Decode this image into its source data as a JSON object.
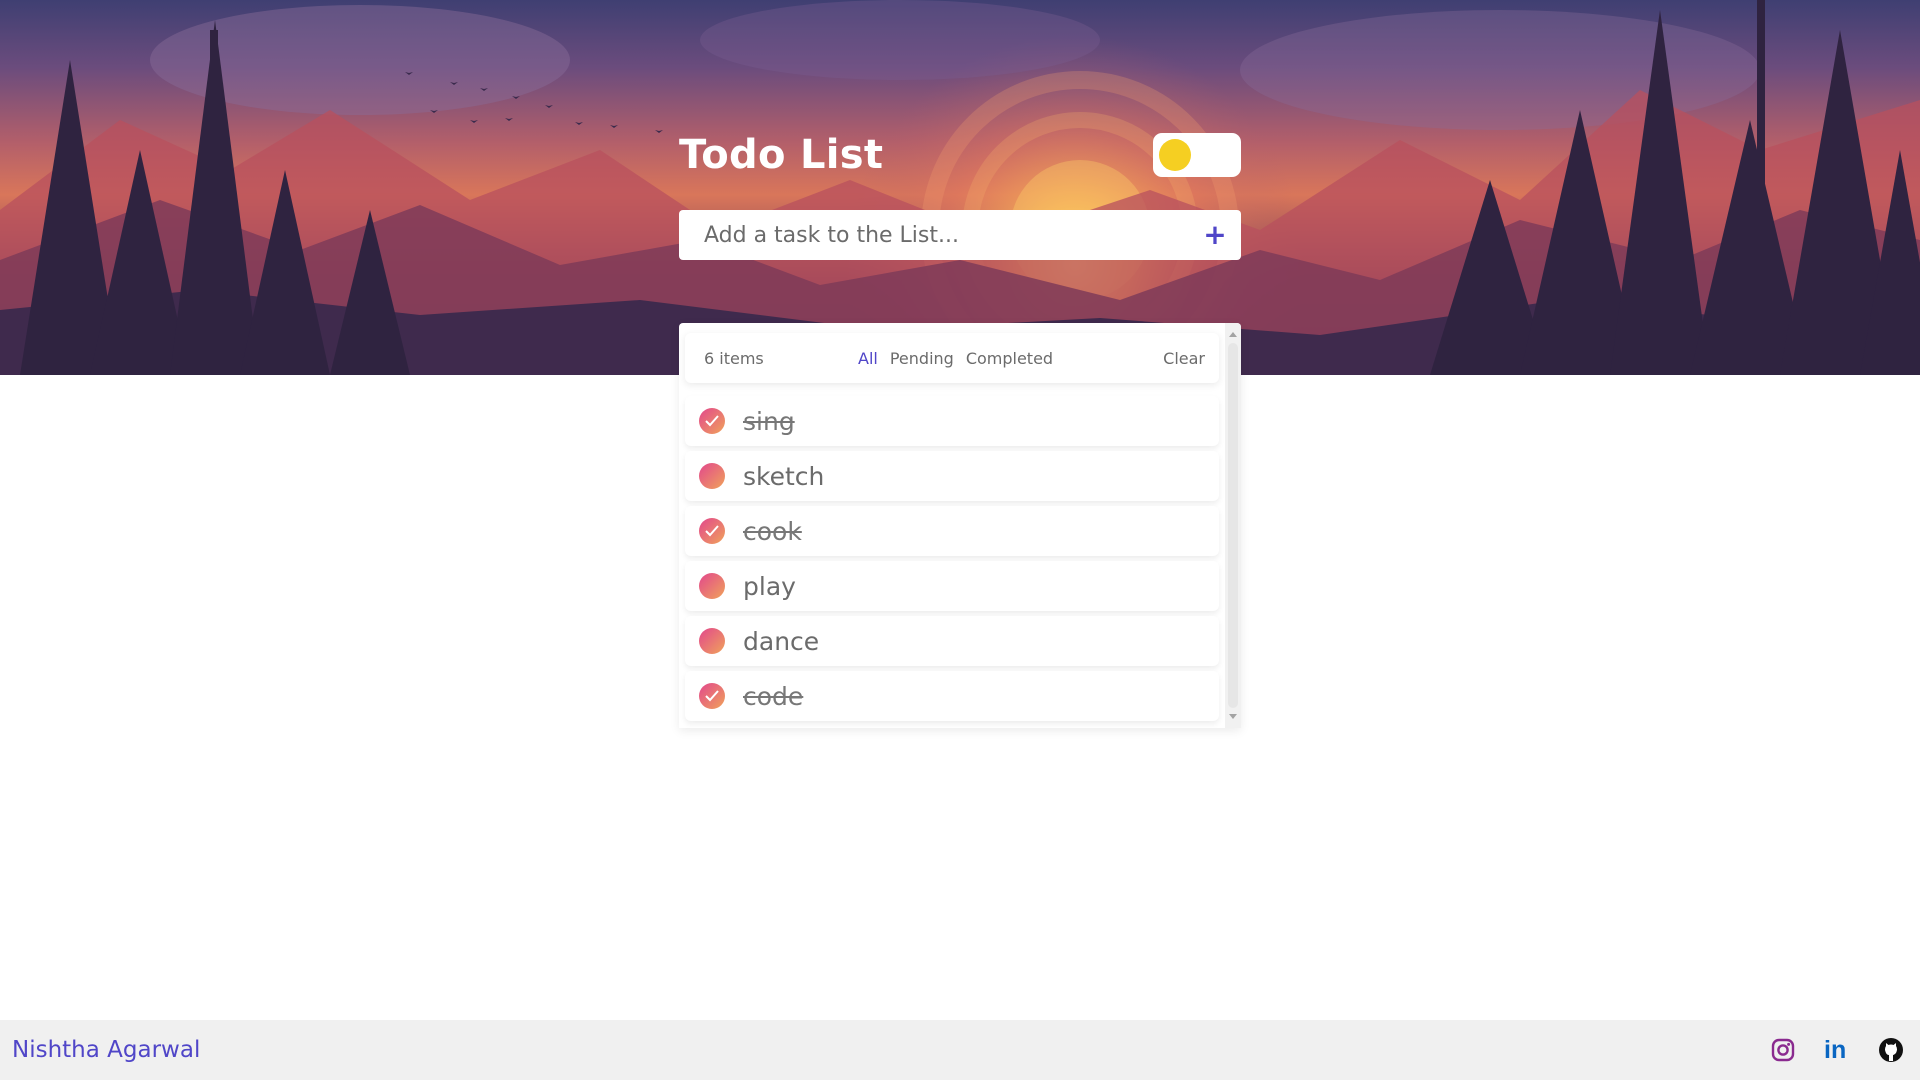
{
  "app": {
    "title": "Todo List",
    "theme_toggle_state": "light"
  },
  "add_task": {
    "placeholder": "Add a task to the List...",
    "button_icon": "plus-icon"
  },
  "filters": {
    "count_label": "6 items",
    "tabs": [
      {
        "label": "All",
        "active": true
      },
      {
        "label": "Pending",
        "active": false
      },
      {
        "label": "Completed",
        "active": false
      }
    ],
    "clear_label": "Clear"
  },
  "tasks": [
    {
      "text": "sing",
      "completed": true
    },
    {
      "text": "sketch",
      "completed": false
    },
    {
      "text": "cook",
      "completed": true
    },
    {
      "text": "play",
      "completed": false
    },
    {
      "text": "dance",
      "completed": false
    },
    {
      "text": "code",
      "completed": true
    }
  ],
  "footer": {
    "author": "Nishtha Agarwal",
    "social": [
      {
        "name": "instagram-icon",
        "color": "#8a2a8f"
      },
      {
        "name": "linkedin-icon",
        "label": "in",
        "color": "#0a66c2"
      },
      {
        "name": "github-icon",
        "color": "#111111"
      }
    ]
  },
  "colors": {
    "accent": "#5046c8",
    "toggle_knob": "#f5cf22",
    "check_gradient_start": "#e2478d",
    "check_gradient_end": "#f0a35a"
  }
}
